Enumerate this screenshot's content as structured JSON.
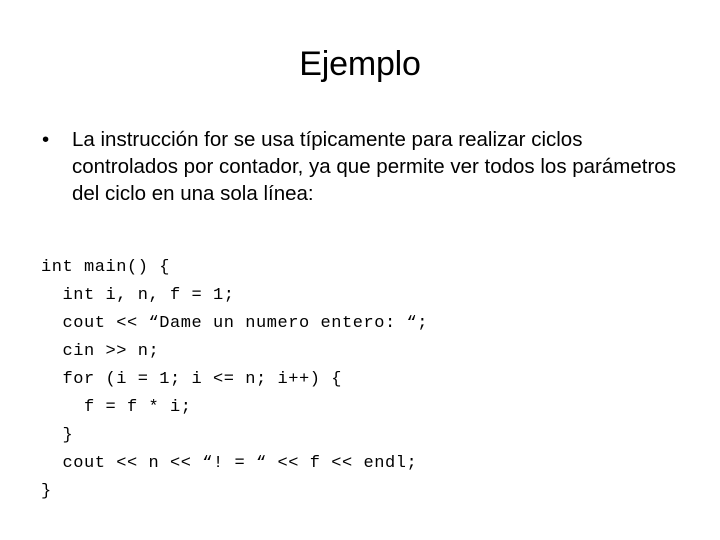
{
  "slide": {
    "title": "Ejemplo",
    "bullets": [
      {
        "marker": "•",
        "text": "La instrucción for se usa típicamente para realizar ciclos controlados por contador, ya que permite ver todos los parámetros del ciclo en una sola línea:"
      }
    ],
    "code": {
      "language": "cpp",
      "lines": [
        "int main() {",
        "  int i, n, f = 1;",
        "  cout << “Dame un numero entero: “;",
        "  cin >> n;",
        "  for (i = 1; i <= n; i++) {",
        "    f = f * i;",
        "  }",
        "  cout << n << “! = “ << f << endl;",
        "}"
      ]
    },
    "colors": {
      "background": "#ffffff",
      "text": "#000000"
    }
  }
}
